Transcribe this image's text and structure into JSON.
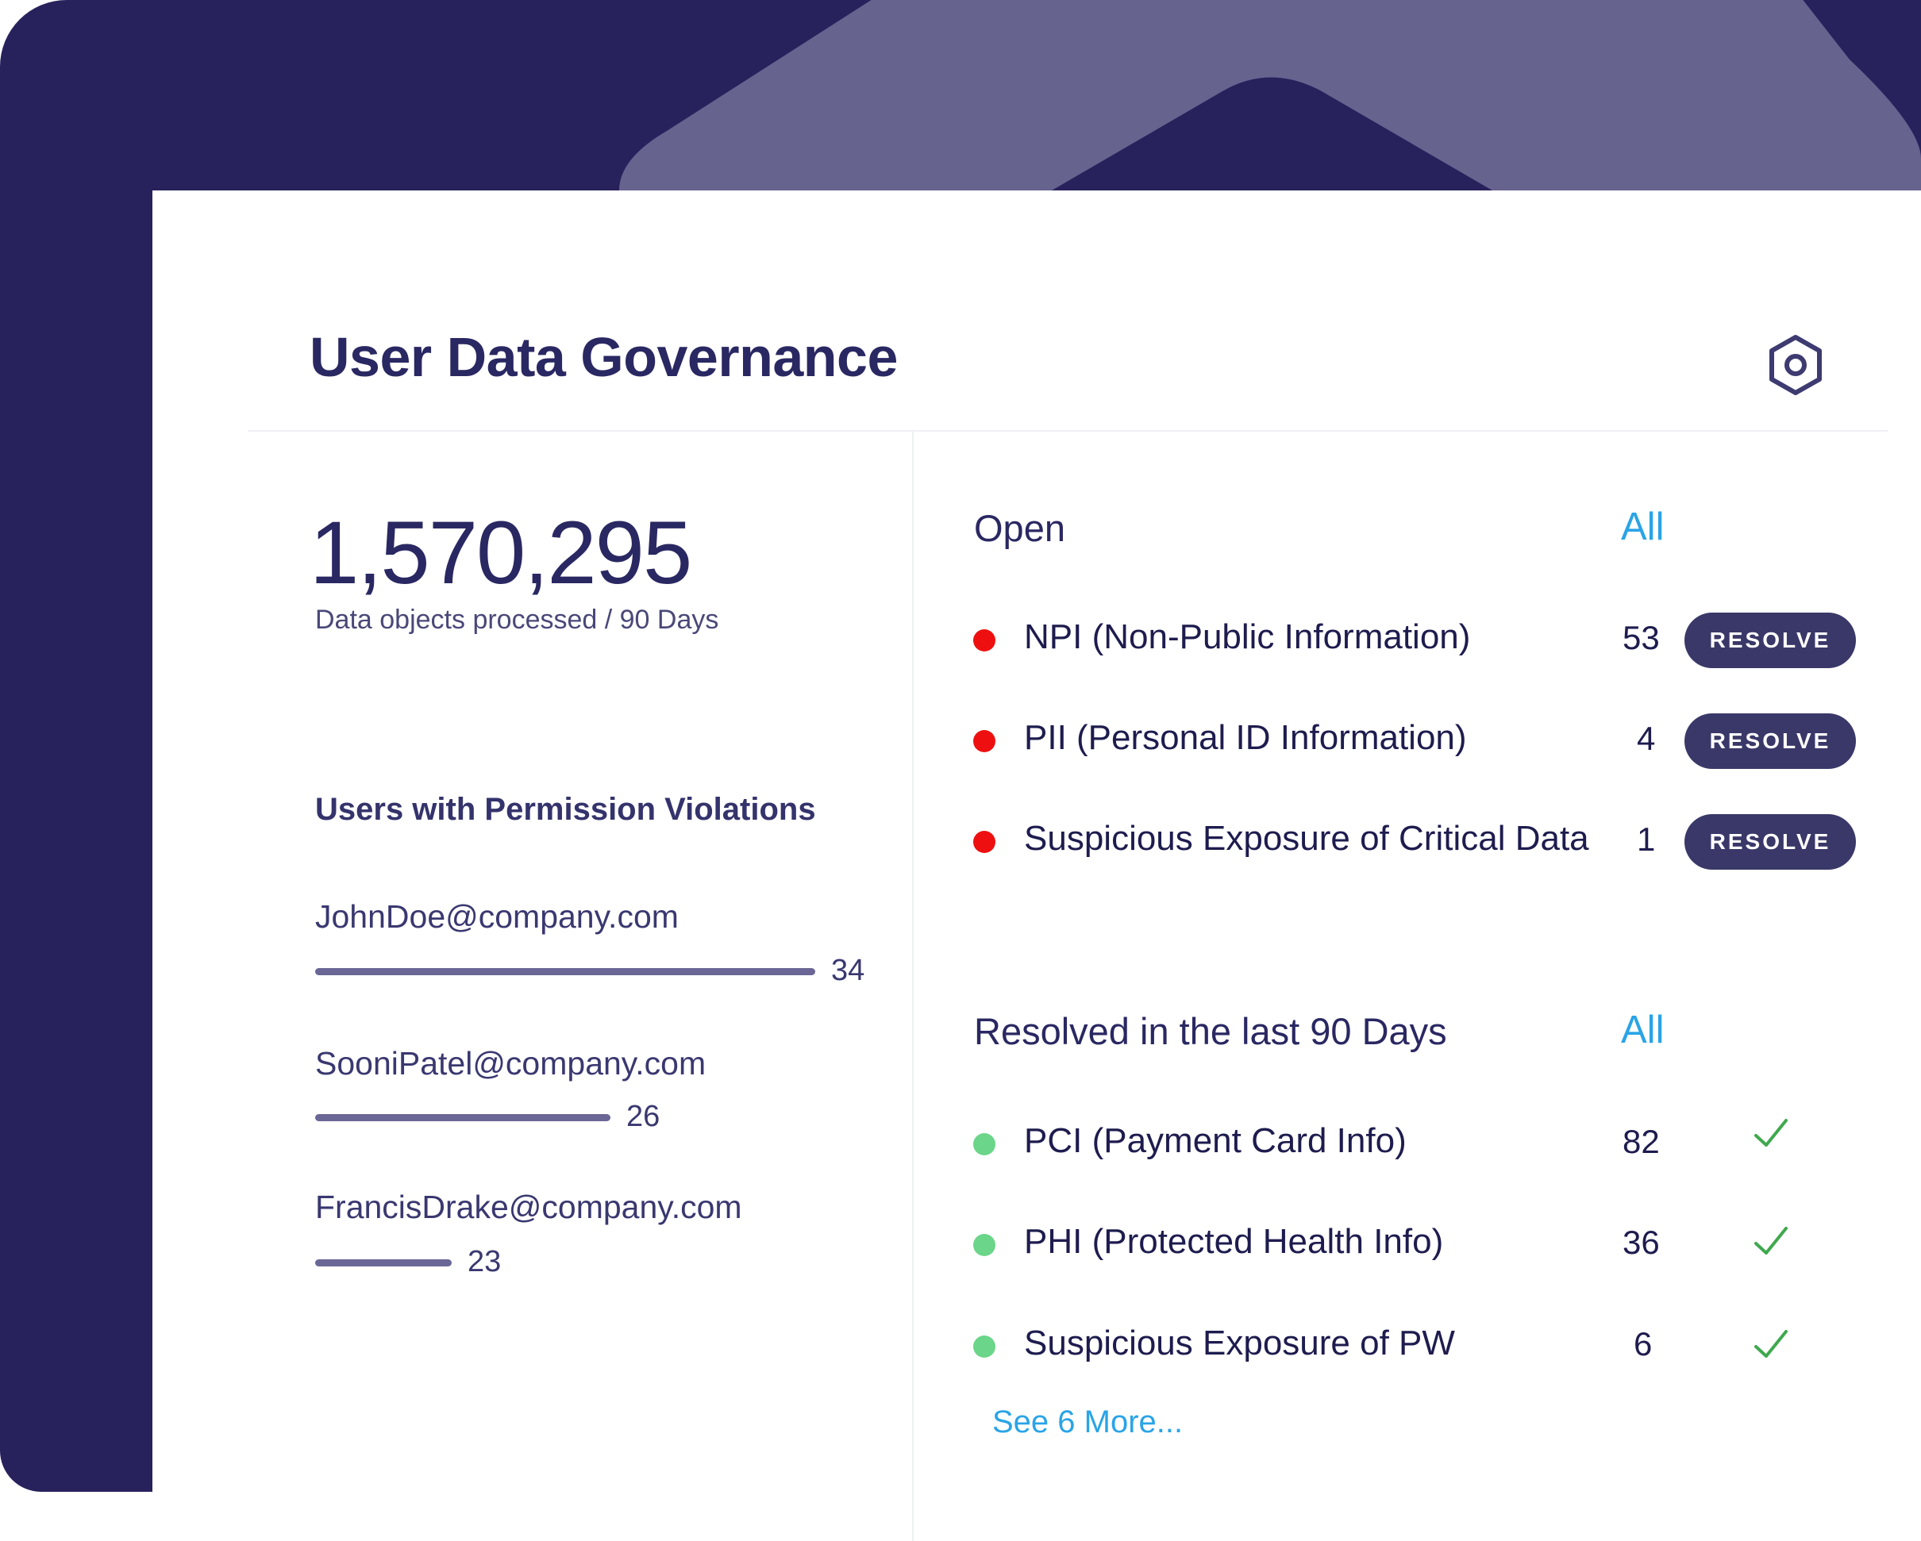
{
  "header": {
    "title": "User Data Governance",
    "settings_icon": "gear-icon"
  },
  "summary": {
    "value": "1,570,295",
    "caption": "Data objects processed / 90 Days"
  },
  "violations": {
    "title": "Users with Permission Violations",
    "users": [
      {
        "email": "JohnDoe@company.com",
        "count": "34",
        "value": 34
      },
      {
        "email": "SooniPatel@company.com",
        "count": "26",
        "value": 26
      },
      {
        "email": "FrancisDrake@company.com",
        "count": "23",
        "value": 23
      }
    ]
  },
  "open": {
    "title": "Open",
    "all_label": "All",
    "items": [
      {
        "label": "NPI (Non-Public Information)",
        "count": "53",
        "action": "RESOLVE"
      },
      {
        "label": "PII (Personal ID Information)",
        "count": "4",
        "action": "RESOLVE"
      },
      {
        "label": "Suspicious Exposure of Critical Data",
        "count": "1",
        "action": "RESOLVE"
      }
    ]
  },
  "resolved": {
    "title": "Resolved in the last 90 Days",
    "all_label": "All",
    "items": [
      {
        "label": "PCI (Payment Card Info)",
        "count": "82"
      },
      {
        "label": "PHI (Protected Health Info)",
        "count": "36"
      },
      {
        "label": "Suspicious Exposure of PW",
        "count": "6"
      }
    ],
    "see_more": "See 6 More..."
  },
  "colors": {
    "background": "#27225c",
    "accent_link": "#2aa4e6",
    "open_status": "#ee1010",
    "resolved_status": "#6bd589",
    "button": "#3a3868"
  }
}
